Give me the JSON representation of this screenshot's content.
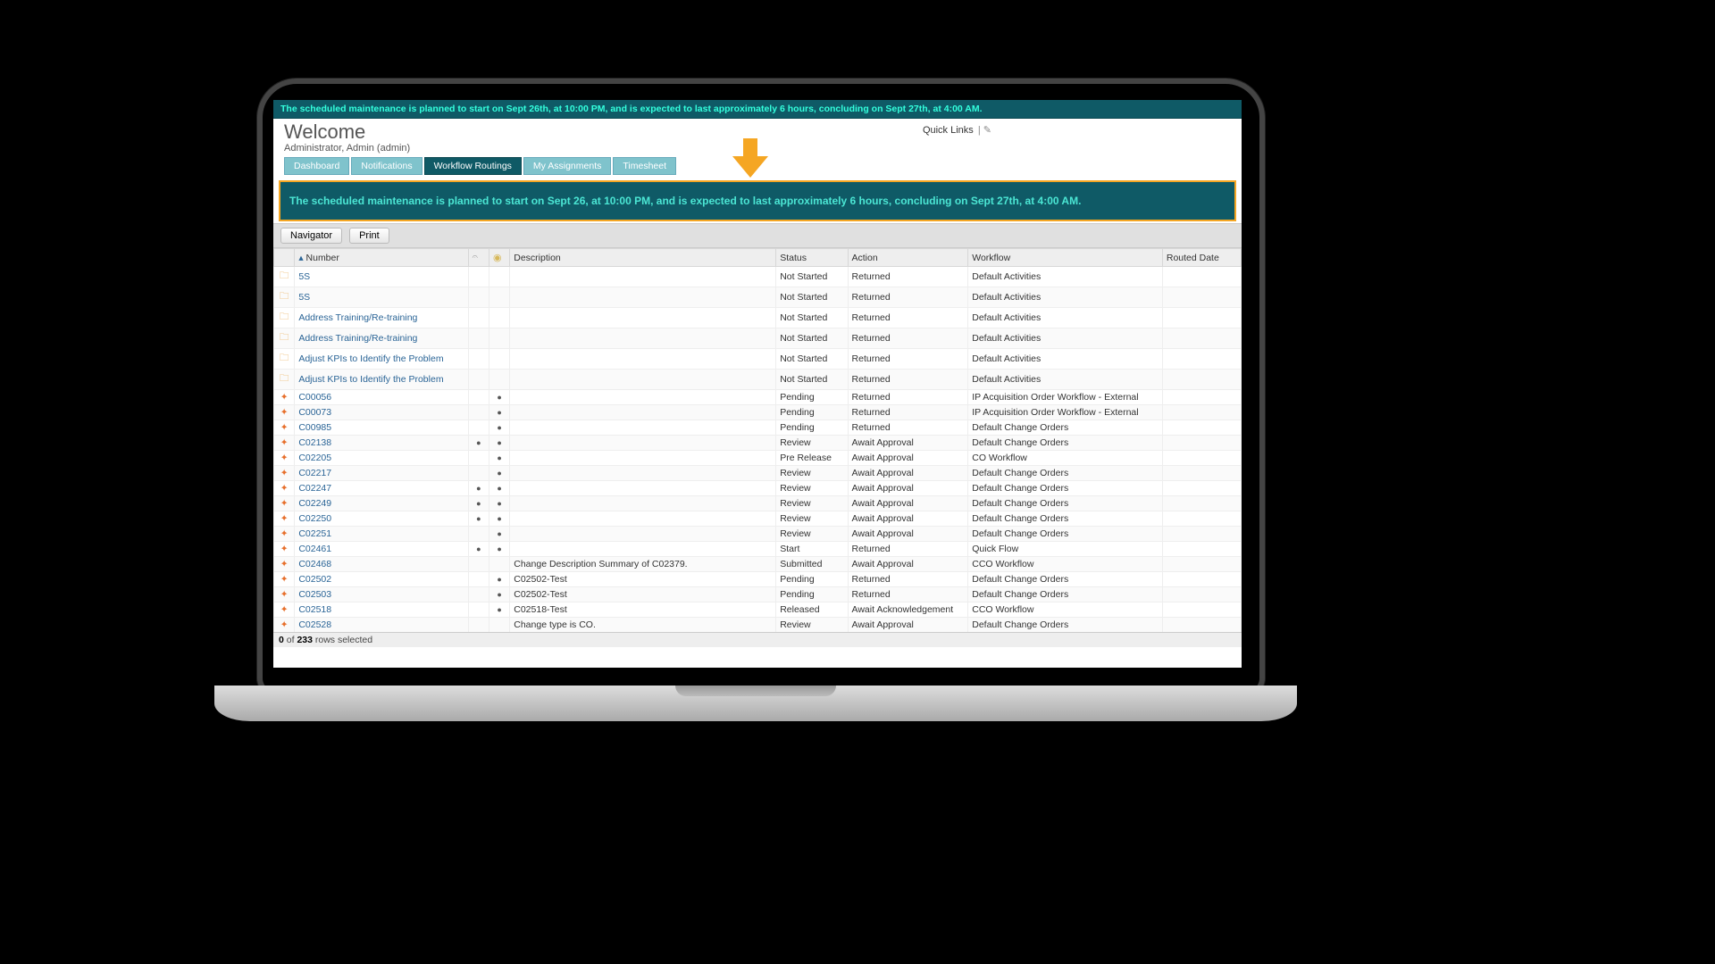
{
  "banner_top": "The scheduled maintenance is planned to start on Sept 26th, at 10:00 PM, and is expected to last approximately 6 hours, concluding on Sept 27th, at 4:00 AM.",
  "header": {
    "welcome": "Welcome",
    "user": "Administrator, Admin (admin)",
    "quicklinks_label": "Quick Links"
  },
  "tabs": [
    {
      "label": "Dashboard",
      "active": false
    },
    {
      "label": "Notifications",
      "active": false
    },
    {
      "label": "Workflow Routings",
      "active": true
    },
    {
      "label": "My Assignments",
      "active": false
    },
    {
      "label": "Timesheet",
      "active": false
    }
  ],
  "callout": "The scheduled maintenance is planned to start on Sept 26, at 10:00 PM, and is expected to last approximately 6 hours, concluding on Sept 27th, at 4:00 AM.",
  "toolbar": {
    "navigator": "Navigator",
    "print": "Print"
  },
  "columns": {
    "number": "Number",
    "description": "Description",
    "status": "Status",
    "action": "Action",
    "workflow": "Workflow",
    "routed_date": "Routed Date"
  },
  "rows": [
    {
      "icon": "doc",
      "number": "5S",
      "attach": false,
      "note": false,
      "desc": "",
      "status": "Not Started",
      "action": "Returned",
      "workflow": "Default Activities",
      "routed": ""
    },
    {
      "icon": "doc",
      "number": "5S",
      "attach": false,
      "note": false,
      "desc": "",
      "status": "Not Started",
      "action": "Returned",
      "workflow": "Default Activities",
      "routed": ""
    },
    {
      "icon": "doc",
      "number": "Address Training/Re-training",
      "attach": false,
      "note": false,
      "desc": "",
      "status": "Not Started",
      "action": "Returned",
      "workflow": "Default Activities",
      "routed": ""
    },
    {
      "icon": "doc",
      "number": "Address Training/Re-training",
      "attach": false,
      "note": false,
      "desc": "",
      "status": "Not Started",
      "action": "Returned",
      "workflow": "Default Activities",
      "routed": ""
    },
    {
      "icon": "doc",
      "number": "Adjust KPIs to Identify the Problem",
      "attach": false,
      "note": false,
      "desc": "",
      "status": "Not Started",
      "action": "Returned",
      "workflow": "Default Activities",
      "routed": ""
    },
    {
      "icon": "doc",
      "number": "Adjust KPIs to Identify the Problem",
      "attach": false,
      "note": false,
      "desc": "",
      "status": "Not Started",
      "action": "Returned",
      "workflow": "Default Activities",
      "routed": ""
    },
    {
      "icon": "route",
      "number": "C00056",
      "attach": false,
      "note": true,
      "desc": "",
      "status": "Pending",
      "action": "Returned",
      "workflow": "IP Acquisition Order Workflow - External",
      "routed": ""
    },
    {
      "icon": "route",
      "number": "C00073",
      "attach": false,
      "note": true,
      "desc": "",
      "status": "Pending",
      "action": "Returned",
      "workflow": "IP Acquisition Order Workflow - External",
      "routed": ""
    },
    {
      "icon": "route",
      "number": "C00985",
      "attach": false,
      "note": true,
      "desc": "",
      "status": "Pending",
      "action": "Returned",
      "workflow": "Default Change Orders",
      "routed": ""
    },
    {
      "icon": "route",
      "number": "C02138",
      "attach": true,
      "note": true,
      "desc": "",
      "status": "Review",
      "action": "Await Approval",
      "workflow": "Default Change Orders",
      "routed": ""
    },
    {
      "icon": "route",
      "number": "C02205",
      "attach": false,
      "note": true,
      "desc": "",
      "status": "Pre Release",
      "action": "Await Approval",
      "workflow": "CO Workflow",
      "routed": ""
    },
    {
      "icon": "route",
      "number": "C02217",
      "attach": false,
      "note": true,
      "desc": "",
      "status": "Review",
      "action": "Await Approval",
      "workflow": "Default Change Orders",
      "routed": ""
    },
    {
      "icon": "route",
      "number": "C02247",
      "attach": true,
      "note": true,
      "desc": "",
      "status": "Review",
      "action": "Await Approval",
      "workflow": "Default Change Orders",
      "routed": ""
    },
    {
      "icon": "route",
      "number": "C02249",
      "attach": true,
      "note": true,
      "desc": "",
      "status": "Review",
      "action": "Await Approval",
      "workflow": "Default Change Orders",
      "routed": ""
    },
    {
      "icon": "route",
      "number": "C02250",
      "attach": true,
      "note": true,
      "desc": "",
      "status": "Review",
      "action": "Await Approval",
      "workflow": "Default Change Orders",
      "routed": ""
    },
    {
      "icon": "route",
      "number": "C02251",
      "attach": false,
      "note": true,
      "desc": "",
      "status": "Review",
      "action": "Await Approval",
      "workflow": "Default Change Orders",
      "routed": ""
    },
    {
      "icon": "route",
      "number": "C02461",
      "attach": true,
      "note": true,
      "desc": "",
      "status": "Start",
      "action": "Returned",
      "workflow": "Quick Flow",
      "routed": ""
    },
    {
      "icon": "route",
      "number": "C02468",
      "attach": false,
      "note": false,
      "desc": "Change Description Summary of C02379.",
      "status": "Submitted",
      "action": "Await Approval",
      "workflow": "CCO Workflow",
      "routed": ""
    },
    {
      "icon": "route",
      "number": "C02502",
      "attach": false,
      "note": true,
      "desc": "C02502-Test",
      "status": "Pending",
      "action": "Returned",
      "workflow": "Default Change Orders",
      "routed": ""
    },
    {
      "icon": "route",
      "number": "C02503",
      "attach": false,
      "note": true,
      "desc": "C02502-Test",
      "status": "Pending",
      "action": "Returned",
      "workflow": "Default Change Orders",
      "routed": ""
    },
    {
      "icon": "route",
      "number": "C02518",
      "attach": false,
      "note": true,
      "desc": "C02518-Test",
      "status": "Released",
      "action": "Await Acknowledgement",
      "workflow": "CCO Workflow",
      "routed": ""
    },
    {
      "icon": "route",
      "number": "C02528",
      "attach": false,
      "note": false,
      "desc": "Change type is CO.",
      "status": "Review",
      "action": "Await Approval",
      "workflow": "Default Change Orders",
      "routed": ""
    }
  ],
  "status_bar": {
    "selected": "0",
    "total": "233",
    "suffix": " rows selected",
    "of": " of "
  }
}
